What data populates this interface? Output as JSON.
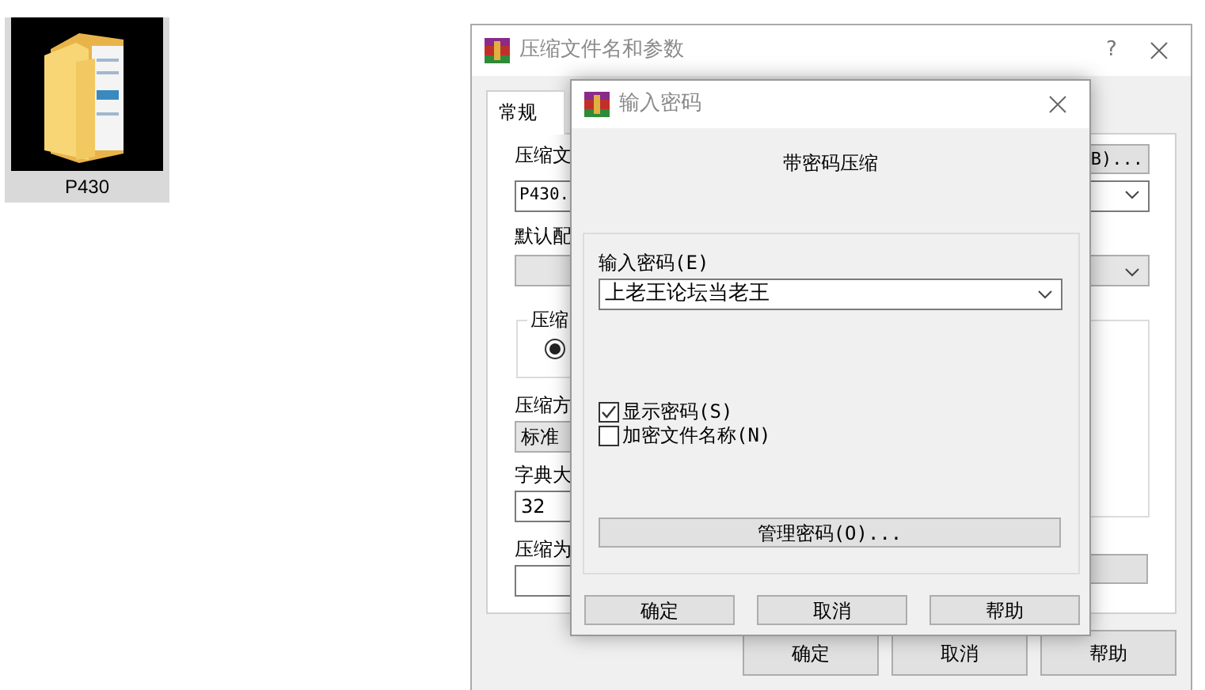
{
  "desktop_icon": {
    "label": "P430",
    "selected": true
  },
  "main_window": {
    "title": "压缩文件名和参数",
    "help": "?",
    "tabs": [
      {
        "label": "常规",
        "selected": true
      }
    ],
    "archive_name": {
      "label": "压缩文",
      "value": "P430.",
      "browse_button": "B)..."
    },
    "profile": {
      "label": "默认配"
    },
    "format_group": {
      "title": "压缩",
      "radio_checked": true
    },
    "method": {
      "label": "压缩方",
      "value": "标准"
    },
    "dictionary": {
      "label": "字典大",
      "value": "32"
    },
    "split": {
      "label": "压缩为"
    },
    "buttons": [
      "确定",
      "取消",
      "帮助"
    ]
  },
  "password_dialog": {
    "title": "输入密码",
    "heading": "带密码压缩",
    "password": {
      "label": "输入密码(E)",
      "value": "上老王论坛当老王"
    },
    "options": [
      {
        "label": "显示密码(S)",
        "checked": true
      },
      {
        "label": "加密文件名称(N)",
        "checked": false
      }
    ],
    "manage_button": "管理密码(O)...",
    "buttons": [
      "确定",
      "取消",
      "帮助"
    ]
  }
}
